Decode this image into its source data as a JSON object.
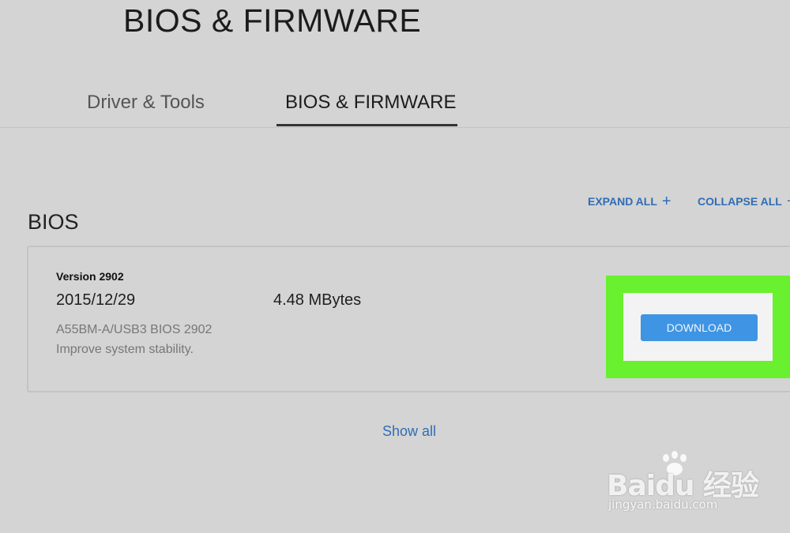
{
  "page": {
    "title": "BIOS & FIRMWARE"
  },
  "tabs": [
    {
      "label": "Driver & Tools",
      "active": false
    },
    {
      "label": "BIOS & FIRMWARE",
      "active": true
    }
  ],
  "controls": {
    "expand_all": "EXPAND ALL",
    "expand_symbol": "+",
    "collapse_all": "COLLAPSE ALL",
    "collapse_symbol": "−"
  },
  "section": {
    "title": "BIOS"
  },
  "bios_entry": {
    "version": "Version 2902",
    "date": "2015/12/29",
    "size": "4.48 MBytes",
    "model": "A55BM-A/USB3 BIOS 2902",
    "note": "Improve system stability.",
    "download_label": "DOWNLOAD"
  },
  "show_all": "Show all",
  "watermark": {
    "brand": "Baidu 经验",
    "url": "jingyan.baidu.com"
  },
  "colors": {
    "background": "#d4d4d4",
    "link_blue": "#2f6db5",
    "button_blue": "#3f95e3",
    "highlight_green": "#69f02e"
  }
}
